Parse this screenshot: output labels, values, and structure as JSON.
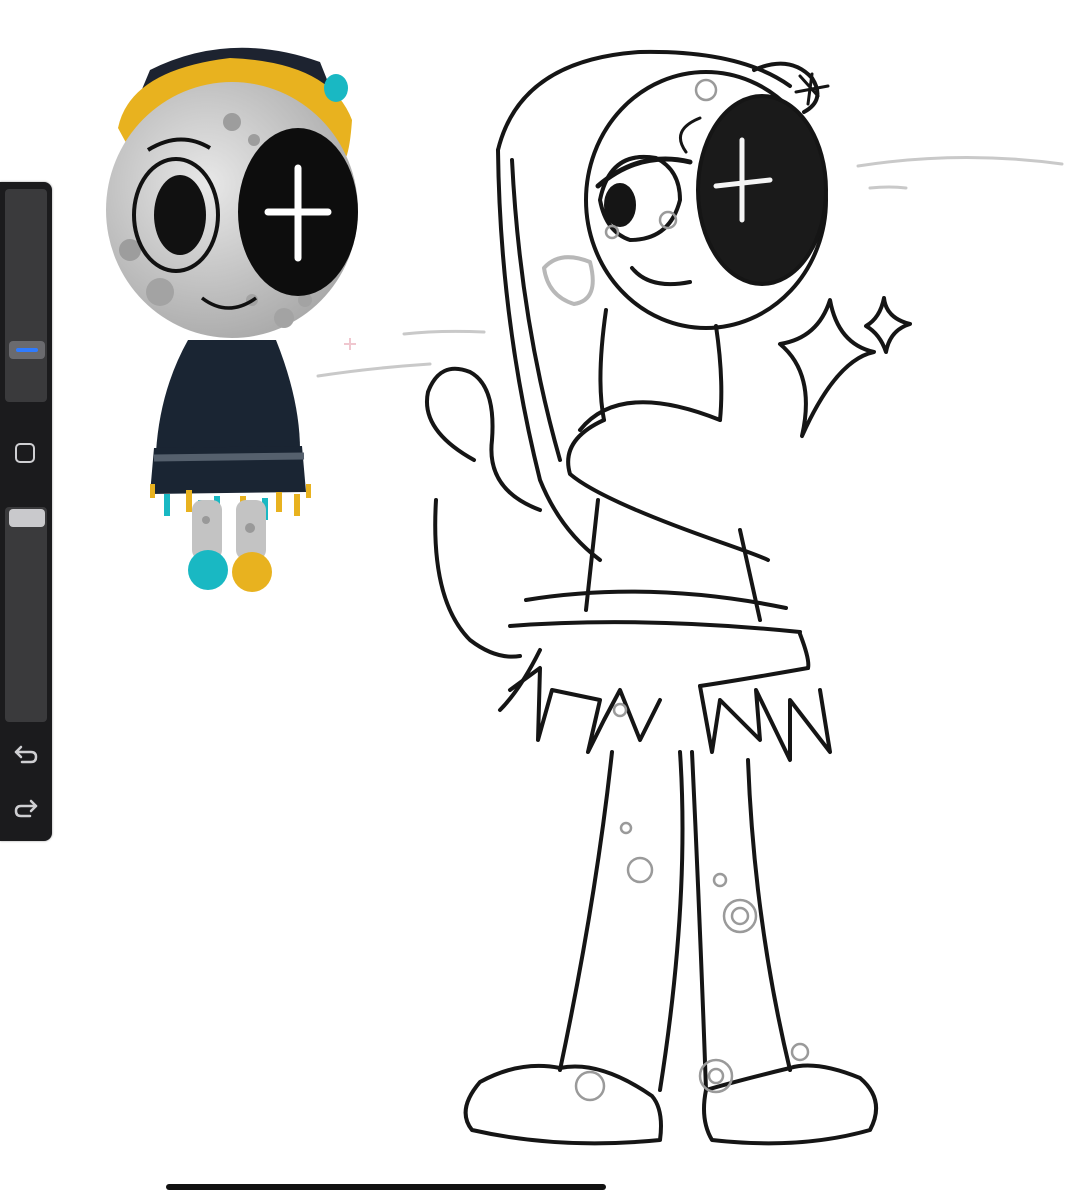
{
  "app": {
    "type": "drawing canvas",
    "sidebar": {
      "brush_size_level": 0.25,
      "brush_opacity_level": 0.97,
      "tools": [
        {
          "name": "modify-square",
          "icon": "square-outline-icon"
        },
        {
          "name": "undo",
          "icon": "undo-arrow-icon"
        },
        {
          "name": "redo",
          "icon": "redo-arrow-icon"
        }
      ]
    },
    "colors": {
      "sidebar_bg": "#1b1b1d",
      "slider_track": "#3a3a3c",
      "accent_blue": "#2f7bff",
      "hat_yellow": "#e8b21f",
      "teal": "#19b8c3",
      "moon_gray": "#c9c9c9",
      "outfit_navy": "#1a2533",
      "sketch_ink": "#151515"
    }
  }
}
